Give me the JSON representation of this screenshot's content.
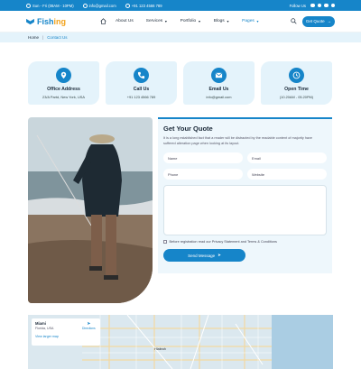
{
  "topbar": {
    "hours": "Sun - Fri (08AM - 10PM)",
    "email": "info@gmail.com",
    "phone": "+91 123 4566 789",
    "follow_label": "Follow Us"
  },
  "header": {
    "logo_main": "Fish",
    "logo_accent": "ing",
    "nav": [
      {
        "label": "About Us",
        "dropdown": false,
        "active": false
      },
      {
        "label": "Services",
        "dropdown": true,
        "active": false
      },
      {
        "label": "Portfolio",
        "dropdown": true,
        "active": false
      },
      {
        "label": "Blogs",
        "dropdown": true,
        "active": false
      },
      {
        "label": "Pages",
        "dropdown": true,
        "active": true
      }
    ],
    "cta_label": "Get Quote"
  },
  "breadcrumb": {
    "home": "Home",
    "current": "Contact Us"
  },
  "info_cards": [
    {
      "title": "Office Address",
      "value": "23/A Partd, New York, USA",
      "icon": "map-pin-icon"
    },
    {
      "title": "Call Us",
      "value": "+91 123 4566 789",
      "icon": "phone-icon"
    },
    {
      "title": "Email Us",
      "value": "info@gmail.com",
      "icon": "mail-icon"
    },
    {
      "title": "Open Time",
      "value": "(10.20AM - 05.20PM)",
      "icon": "clock-icon"
    }
  ],
  "quote": {
    "title": "Get Your Quote",
    "description": "It is a long established fact that a reader will be distracted by the readable content of majority have suffered alteration page when looking at its layout.",
    "name_placeholder": "Name",
    "email_placeholder": "Email",
    "phone_placeholder": "Phone",
    "website_placeholder": "Website",
    "terms": "Before registration read our Privacy Statement and Terms & Conditions",
    "send_label": "Send Message"
  },
  "map": {
    "place": "Miami",
    "sub": "Florida, USA",
    "larger_map": "View larger map",
    "directions": "Directions",
    "city_label": "Hialeah"
  },
  "colors": {
    "primary": "#1685c9",
    "accent": "#f2a21b",
    "light": "#e4f3fb"
  }
}
